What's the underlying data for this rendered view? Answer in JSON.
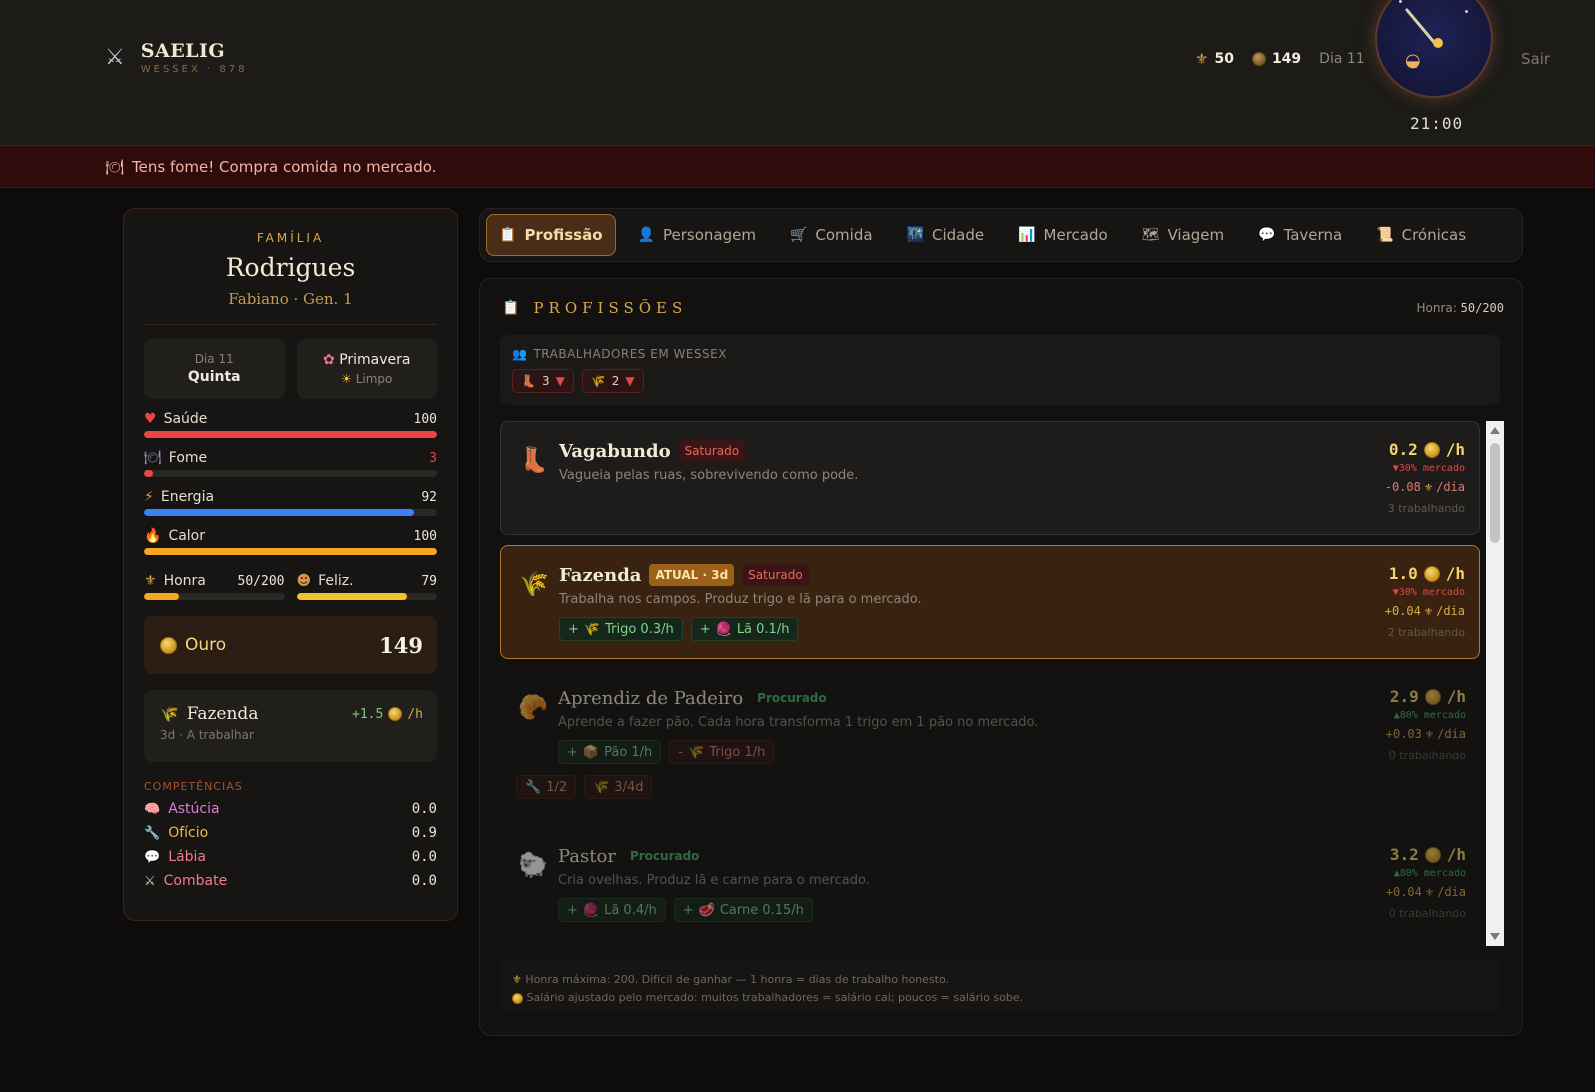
{
  "header": {
    "brand_title": "SAELIG",
    "brand_sub": "WESSEX · 878",
    "honor": "50",
    "gold": "149",
    "day": "Dia 11",
    "time": "21:00",
    "logout": "Sair"
  },
  "alert": {
    "text": "Tens fome! Compra comida no mercado."
  },
  "family": {
    "label": "FAMÍLIA",
    "name": "Rodrigues",
    "sub": "Fabiano · Gen. 1",
    "day_label": "Dia 11",
    "weekday": "Quinta",
    "season": "Primavera",
    "weather": "Limpo"
  },
  "stats": [
    {
      "name": "Saúde",
      "value": "100",
      "pct": 100,
      "color": "#e84545"
    },
    {
      "name": "Fome",
      "value": "3",
      "pct": 3,
      "color": "#e84545"
    },
    {
      "name": "Energia",
      "value": "92",
      "pct": 92,
      "color": "#3b82f6"
    },
    {
      "name": "Calor",
      "value": "100",
      "pct": 100,
      "color": "#f5a623"
    }
  ],
  "honra": {
    "label": "Honra",
    "value": "50/200",
    "pct": 25
  },
  "feliz": {
    "label": "Feliz.",
    "value": "79",
    "pct": 79
  },
  "gold_box": {
    "label": "Ouro",
    "value": "149"
  },
  "job_box": {
    "name": "Fazenda",
    "rate": "+1.5",
    "unit": "/h",
    "status": "3d · A trabalhar"
  },
  "competencias": {
    "label": "COMPETÊNCIAS",
    "items": [
      {
        "name": "Astúcia",
        "value": "0.0",
        "color": "#e27ad8"
      },
      {
        "name": "Ofício",
        "value": "0.9",
        "color": "#f0b93e"
      },
      {
        "name": "Lábia",
        "value": "0.0",
        "color": "#f07c8c"
      },
      {
        "name": "Combate",
        "value": "0.0",
        "color": "#f07c8c"
      }
    ]
  },
  "tabs": [
    "Profissão",
    "Personagem",
    "Comida",
    "Cidade",
    "Mercado",
    "Viagem",
    "Taverna",
    "Crónicas"
  ],
  "main": {
    "title": "PROFISSÕES",
    "honra_label": "Honra:",
    "honra_value": "50/200",
    "workers_label": "TRABALHADORES EM WESSEX",
    "worker_chips": [
      "3",
      "2"
    ],
    "footer1": "Honra máxima: 200. Difícil de ganhar — 1 honra = dias de trabalho honesto.",
    "footer2": "Salário ajustado pelo mercado: muitos trabalhadores = salário cai; poucos = salário sobe."
  },
  "jobs": [
    {
      "name": "Vagabundo",
      "badge": "Saturado",
      "desc": "Vagueia pelas ruas, sobrevivendo como pode.",
      "rate": "0.2",
      "unit": "/h",
      "market": "▼30% mercado",
      "honor": "-0.08",
      "honor_unit": "/dia",
      "workers": "3 trabalhando"
    },
    {
      "name": "Fazenda",
      "badge_cur": "ATUAL · 3d",
      "badge": "Saturado",
      "desc": "Trabalha nos campos. Produz trigo e lã para o mercado.",
      "chips": [
        "Trigo 0.3/h",
        "Lã 0.1/h"
      ],
      "rate": "1.0",
      "unit": "/h",
      "market": "▼30% mercado",
      "honor": "+0.04",
      "honor_unit": "/dia",
      "workers": "2 trabalhando"
    },
    {
      "name": "Aprendiz de Padeiro",
      "badge": "Procurado",
      "desc": "Aprende a fazer pão. Cada hora transforma 1 trigo em 1 pão no mercado.",
      "chip_pos": "Pão 1/h",
      "chip_neg": "Trigo 1/h",
      "reqs": [
        "1/2",
        "3/4d"
      ],
      "rate": "2.9",
      "unit": "/h",
      "market": "▲80% mercado",
      "honor": "+0.03",
      "honor_unit": "/dia",
      "workers": "0 trabalhando"
    },
    {
      "name": "Pastor",
      "badge": "Procurado",
      "desc": "Cria ovelhas. Produz lã e carne para o mercado.",
      "chips": [
        "Lã 0.4/h",
        "Carne 0.15/h"
      ],
      "rate": "3.2",
      "unit": "/h",
      "market": "▲80% mercado",
      "honor": "+0.04",
      "honor_unit": "/dia",
      "workers": "0 trabalhando"
    }
  ]
}
